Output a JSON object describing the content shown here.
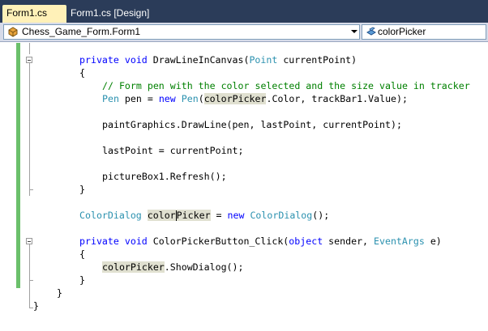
{
  "tabs": [
    {
      "label": "Form1.cs",
      "active": true
    },
    {
      "label": "Form1.cs [Design]",
      "active": false
    }
  ],
  "navbar": {
    "class_dropdown": "Chess_Game_Form.Form1",
    "member_dropdown": "colorPicker",
    "class_icon": "class-icon",
    "member_icon": "field-icon"
  },
  "code": {
    "l1": {
      "kw1": "private",
      "kw2": "void",
      "name": "DrawLineInCanvas(",
      "type": "Point",
      "rest": " currentPoint)"
    },
    "l2": "{",
    "l3": "// Form pen with the color selected and the size value in tracker",
    "l4": {
      "type": "Pen",
      "a": " pen = ",
      "kw": "new",
      "type2": "Pen",
      "b": "(",
      "hl": "colorPicker",
      "c": ".Color, trackBar1.Value);"
    },
    "l6": "paintGraphics.DrawLine(pen, lastPoint, currentPoint);",
    "l8": "lastPoint = currentPoint;",
    "l10": "pictureBox1.Refresh();",
    "l11": "}",
    "l13": {
      "type": "ColorDialog",
      "hl_a": "color",
      "hl_b": "Picker",
      "a": " = ",
      "kw": "new",
      "type2": "ColorDialog",
      "b": "();"
    },
    "l15": {
      "kw1": "private",
      "kw2": "void",
      "name": "ColorPickerButton_Click(",
      "kw3": "object",
      "a": " sender, ",
      "type": "EventArgs",
      "b": " e)"
    },
    "l16": "{",
    "l17": {
      "hl": "colorPicker",
      "a": ".ShowDialog();"
    },
    "l18": "}",
    "l19": "}",
    "l20": "}"
  }
}
